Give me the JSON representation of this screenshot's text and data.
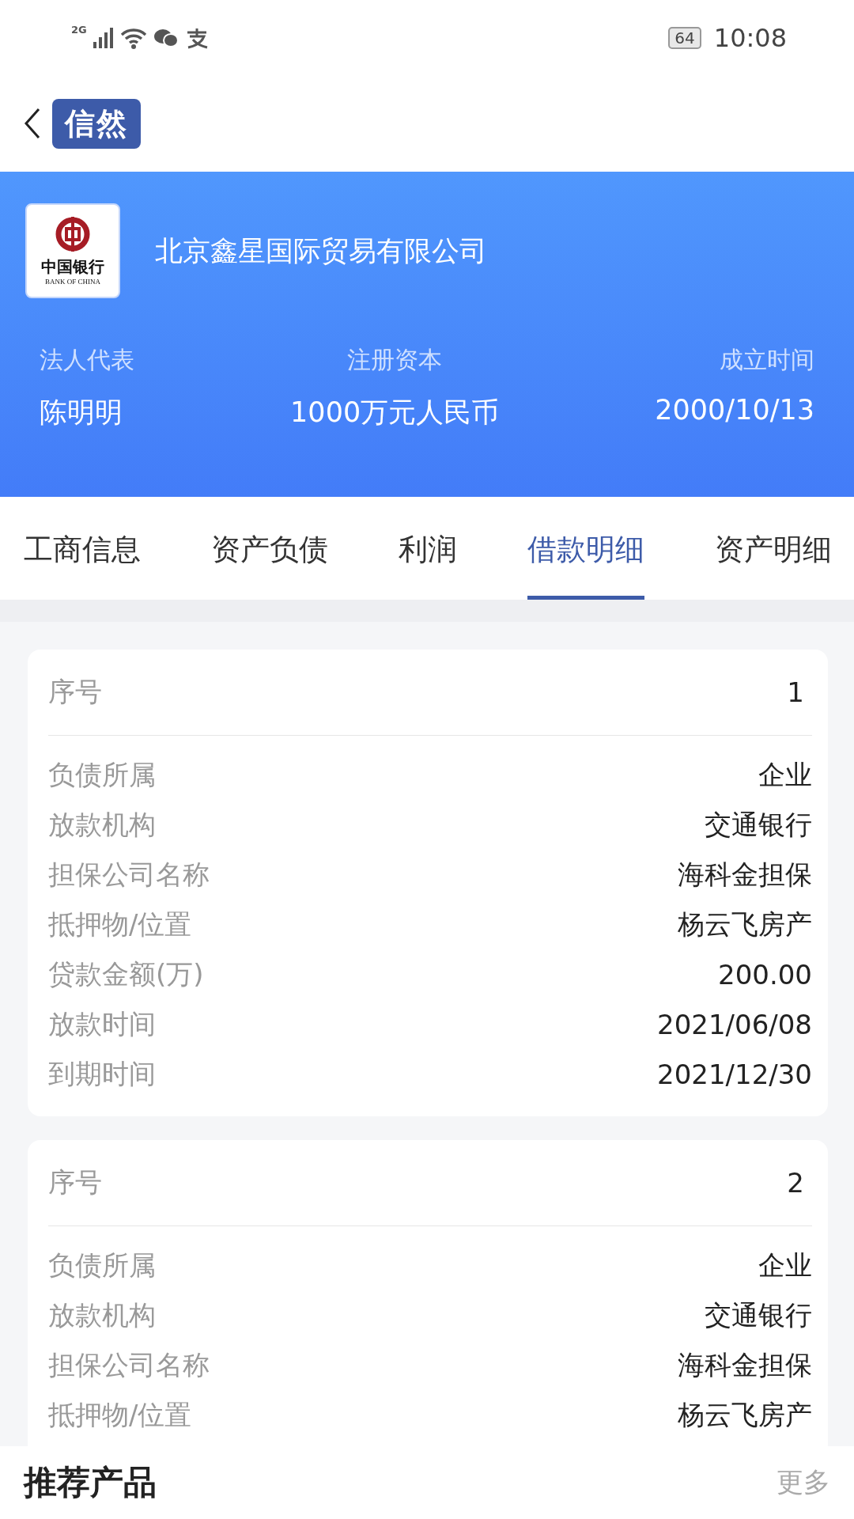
{
  "status_bar": {
    "network": "2G",
    "battery": "64",
    "time": "10:08"
  },
  "nav": {
    "logo": "信然"
  },
  "company": {
    "logo_cn": "中国银行",
    "logo_en": "BANK OF CHINA",
    "name": "北京鑫星国际贸易有限公司",
    "facts": [
      {
        "label": "法人代表",
        "value": "陈明明"
      },
      {
        "label": "注册资本",
        "value": "1000万元人民币"
      },
      {
        "label": "成立时间",
        "value": "2000/10/13"
      }
    ]
  },
  "tabs": [
    {
      "label": "工商信息",
      "selected": false
    },
    {
      "label": "资产负债",
      "selected": false
    },
    {
      "label": "利润",
      "selected": false
    },
    {
      "label": "借款明细",
      "selected": true
    },
    {
      "label": "资产明细",
      "selected": false
    }
  ],
  "loans": [
    {
      "index_label": "序号",
      "index": "1",
      "rows": [
        {
          "label": "负债所属",
          "value": "企业"
        },
        {
          "label": "放款机构",
          "value": "交通银行"
        },
        {
          "label": "担保公司名称",
          "value": "海科金担保"
        },
        {
          "label": "抵押物/位置",
          "value": "杨云飞房产"
        },
        {
          "label": "贷款金额(万)",
          "value": "200.00"
        },
        {
          "label": "放款时间",
          "value": "2021/06/08"
        },
        {
          "label": "到期时间",
          "value": "2021/12/30"
        }
      ]
    },
    {
      "index_label": "序号",
      "index": "2",
      "rows": [
        {
          "label": "负债所属",
          "value": "企业"
        },
        {
          "label": "放款机构",
          "value": "交通银行"
        },
        {
          "label": "担保公司名称",
          "value": "海科金担保"
        },
        {
          "label": "抵押物/位置",
          "value": "杨云飞房产"
        }
      ]
    }
  ],
  "bottom_bar": {
    "title": "推荐产品",
    "more": "更多"
  }
}
